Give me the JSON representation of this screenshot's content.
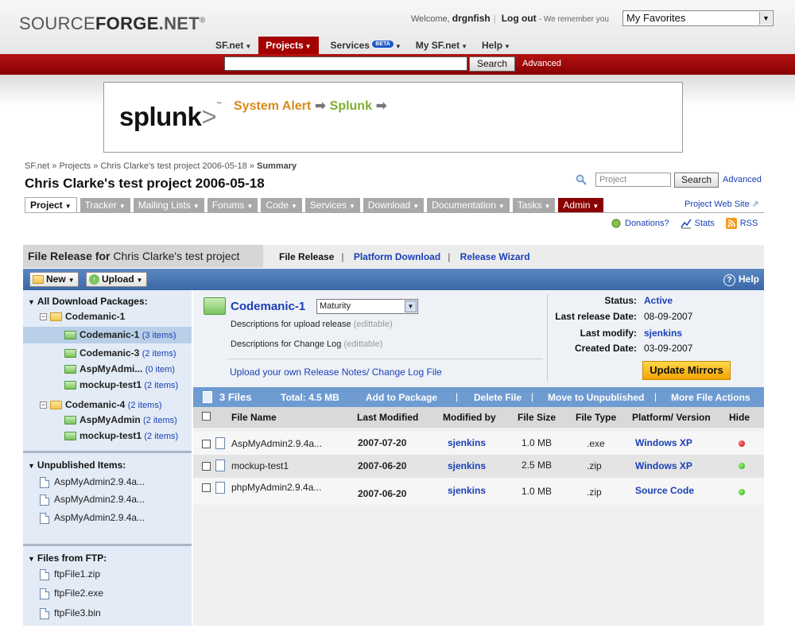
{
  "header": {
    "logo_bold": "FORGE",
    "logo_pre": "SOURCE",
    "logo_post": ".NET",
    "logo_reg": "®",
    "welcome": "Welcome,",
    "username": "drgnfish",
    "logout": "Log out",
    "remember": "- We remember you",
    "favorites": "My Favorites",
    "nav": [
      {
        "label": "SF.net"
      },
      {
        "label": "Projects"
      },
      {
        "label": "Services",
        "badge": "BETA"
      },
      {
        "label": "My SF.net"
      },
      {
        "label": "Help"
      }
    ],
    "search_button": "Search",
    "advanced": "Advanced"
  },
  "ad": {
    "logo": "splunk",
    "logo_mark": ">",
    "tm": "™",
    "text_a": "System Alert",
    "arrow": "➡",
    "text_b": "Splunk"
  },
  "project": {
    "breadcrumb": [
      "SF.net",
      "Projects",
      "Chris Clarke's test project 2006-05-18",
      "Summary"
    ],
    "crumb_sep": "»",
    "title": "Chris Clarke's test project 2006-05-18",
    "search_placeholder": "Project",
    "search_button": "Search",
    "advanced": "Advanced",
    "tabs": [
      "Project",
      "Tracker",
      "Mailing Lists",
      "Forums",
      "Code",
      "Services",
      "Download",
      "Documentation",
      "Tasks",
      "Admin"
    ],
    "web_site": "Project Web Site",
    "donations": "Donations?",
    "stats": "Stats",
    "rss": "RSS"
  },
  "file_release": {
    "title_bold": "File Release for",
    "title_rest": "Chris Clarke's test project",
    "links": [
      "File Release",
      "Platform Download",
      "Release Wizard"
    ],
    "sep": "|",
    "new_label": "New",
    "upload_label": "Upload",
    "help": "Help"
  },
  "sidebar": {
    "all_title": "All Download Packages:",
    "tree": [
      {
        "label": "Codemanic-1",
        "count": ""
      },
      {
        "label": "Codemanic-1",
        "count": "(3 items)"
      },
      {
        "label": "Codemanic-3",
        "count": "(2 items)"
      },
      {
        "label": "AspMyAdmi...",
        "count": "(0 item)"
      },
      {
        "label": "mockup-test1",
        "count": "(2 items)"
      },
      {
        "label": "Codemanic-4",
        "count": "(2 items)"
      },
      {
        "label": "AspMyAdmin",
        "count": "(2 items)"
      },
      {
        "label": "mockup-test1",
        "count": "(2 items)"
      }
    ],
    "unpub_title": "Unpublished Items:",
    "unpublished": [
      "AspMyAdmin2.9.4a...",
      "AspMyAdmin2.9.4a...",
      "AspMyAdmin2.9.4a..."
    ],
    "ftp_title": "Files from FTP:",
    "ftp": [
      "ftpFile1.zip",
      "ftpFile2.exe",
      "ftpFile3.bin"
    ]
  },
  "package": {
    "name": "Codemanic-1",
    "maturity": "Maturity",
    "desc_upload": "Descriptions for upload release",
    "desc_changelog": "Descriptions for Change Log",
    "editable": "(edittable)",
    "upload_notes": "Upload your own Release Notes/ Change Log File",
    "status_label": "Status:",
    "status": "Active",
    "last_release_label": "Last release Date:",
    "last_release": "08-09-2007",
    "last_modify_label": "Last modify:",
    "last_modify": "sjenkins",
    "created_label": "Created Date:",
    "created": "03-09-2007",
    "update_mirrors": "Update Mirrors"
  },
  "files": {
    "count": "3 Files",
    "total": "Total: 4.5 MB",
    "actions": [
      "Add to Package",
      "Delete File",
      "Move to Unpublished",
      "More File Actions"
    ],
    "columns": [
      "File Name",
      "Last Modified",
      "Modified by",
      "File Size",
      "File Type",
      "Platform/ Version",
      "Hide"
    ],
    "rows": [
      {
        "name": "AspMyAdmin2.9.4a...",
        "modified": "2007-07-20",
        "by": "sjenkins",
        "size": "1.0 MB",
        "type": ".exe",
        "platform": "Windows XP",
        "hide": "red"
      },
      {
        "name": "mockup-test1",
        "modified": "2007-06-20",
        "by": "sjenkins",
        "size": "2.5 MB",
        "type": ".zip",
        "platform": "Windows XP",
        "hide": "green"
      },
      {
        "name": "phpMyAdmin2.9.4a...",
        "modified": "2007-06-20",
        "by": "sjenkins",
        "size": "1.0 MB",
        "type": ".zip",
        "platform": "Source Code",
        "hide": "green"
      }
    ]
  }
}
